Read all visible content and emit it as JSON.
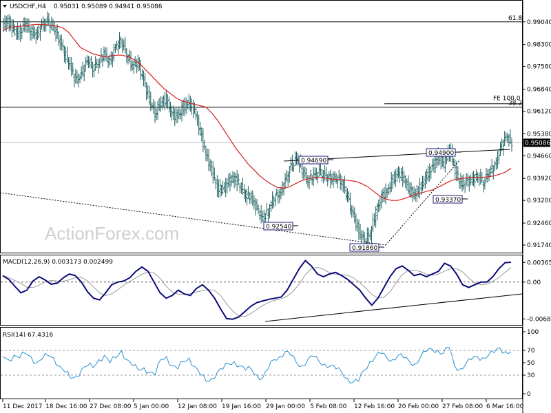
{
  "header": {
    "symbol": "USDCHF,H4",
    "ohlc": "0.95031 0.95089 0.94941 0.95086"
  },
  "watermark": "ActionForex.com",
  "colors": {
    "candle": "#1c5f5f",
    "ma": "#d42020",
    "macd": "#0a0a78",
    "signal": "#9a9a9a",
    "rsi": "#2a8fd0",
    "grid": "#000000"
  },
  "chart_data": [
    {
      "type": "candlestick",
      "title": "USDCHF,H4",
      "price_axis": {
        "ylim": [
          0.9128,
          0.9131
        ],
        "ticks": [
          "0.99040",
          "0.98300",
          "0.97580",
          "0.96840",
          "0.96120",
          "0.95380",
          "0.94660",
          "0.93920",
          "0.93200",
          "0.92460",
          "0.91740"
        ]
      },
      "current_price": "0.95086",
      "x_tick_labels": [
        "11 Dec 2017",
        "18 Dec 16:00",
        "27 Dec 08:00",
        "5 Jan 00:00",
        "12 Jan 08:00",
        "19 Jan 16:00",
        "29 Jan 00:00",
        "5 Feb 08:00",
        "12 Feb 16:00",
        "20 Feb 00:00",
        "27 Feb 08:00",
        "6 Mar 16:00"
      ],
      "close_path": [
        0.9895,
        0.9905,
        0.988,
        0.986,
        0.99,
        0.9875,
        0.986,
        0.989,
        0.9905,
        0.9885,
        0.985,
        0.9805,
        0.976,
        0.971,
        0.973,
        0.978,
        0.9755,
        0.977,
        0.98,
        0.977,
        0.982,
        0.9845,
        0.98,
        0.976,
        0.977,
        0.971,
        0.965,
        0.9605,
        0.964,
        0.965,
        0.96,
        0.9595,
        0.9625,
        0.964,
        0.961,
        0.9545,
        0.947,
        0.942,
        0.936,
        0.9355,
        0.938,
        0.9395,
        0.937,
        0.934,
        0.933,
        0.929,
        0.926,
        0.9285,
        0.933,
        0.934,
        0.938,
        0.943,
        0.946,
        0.942,
        0.9385,
        0.94,
        0.941,
        0.94,
        0.939,
        0.9395,
        0.938,
        0.933,
        0.927,
        0.922,
        0.9186,
        0.9215,
        0.928,
        0.933,
        0.935,
        0.939,
        0.941,
        0.939,
        0.935,
        0.9337,
        0.937,
        0.94,
        0.943,
        0.946,
        0.944,
        0.949,
        0.942,
        0.937,
        0.938,
        0.9385,
        0.94,
        0.938,
        0.9415,
        0.943,
        0.949,
        0.953,
        0.9509
      ],
      "ma_path": [
        0.9875,
        0.9885,
        0.9888,
        0.989,
        0.9892,
        0.9895,
        0.9896,
        0.9895,
        0.9893,
        0.989,
        0.9885,
        0.987,
        0.9845,
        0.982,
        0.981,
        0.98,
        0.9795,
        0.979,
        0.9792,
        0.9795,
        0.9795,
        0.979,
        0.978,
        0.9765,
        0.9745,
        0.9725,
        0.9705,
        0.9685,
        0.967,
        0.9655,
        0.9645,
        0.964,
        0.9635,
        0.963,
        0.9625,
        0.9605,
        0.958,
        0.955,
        0.952,
        0.949,
        0.9465,
        0.944,
        0.942,
        0.94,
        0.9385,
        0.9372,
        0.9362,
        0.936,
        0.9365,
        0.9375,
        0.9385,
        0.939,
        0.9395,
        0.9395,
        0.9393,
        0.939,
        0.9388,
        0.9387,
        0.9385,
        0.9382,
        0.9375,
        0.9365,
        0.935,
        0.9335,
        0.9325,
        0.932,
        0.932,
        0.9325,
        0.9332,
        0.934,
        0.9345,
        0.935,
        0.9355,
        0.9365,
        0.9375,
        0.9385,
        0.939,
        0.9392,
        0.9395,
        0.9395,
        0.9395,
        0.9397,
        0.94,
        0.9405,
        0.9412,
        0.9425
      ],
      "levels": [
        {
          "label": "61.8",
          "price": 0.9904,
          "style": "hline"
        },
        {
          "label": "FE 100.0",
          "price": 0.9625,
          "style": "hline"
        },
        {
          "label": "38.2",
          "price": 0.9625,
          "style": "hline-label"
        }
      ],
      "annotations": [
        "0.94690",
        "0.94900",
        "0.93370",
        "0.92540",
        "0.91860"
      ],
      "trendlines": [
        {
          "name": "neckline",
          "from": [
            0.9469,
            0.9469
          ],
          "to": [
            0.9495,
            0.9495
          ]
        },
        {
          "name": "support",
          "from": 0.937,
          "to": 0.9186
        },
        {
          "name": "rise",
          "from": 0.9186,
          "to": 0.949,
          "dashed": true
        }
      ]
    },
    {
      "type": "line",
      "title": "MACD(12,26,9) 0.003173 0.002499",
      "ylim": [
        -0.0072,
        0.0042
      ],
      "ticks": [
        "0.00365",
        "0.00",
        "-0.006858"
      ],
      "macd_path": [
        0.0012,
        0.0005,
        -0.0008,
        -0.002,
        -0.0015,
        0.0002,
        0.001,
        0.0004,
        -0.0004,
        -0.0002,
        0.0008,
        0.0015,
        0.0012,
        0.0,
        -0.0018,
        -0.003,
        -0.0033,
        -0.002,
        -0.0005,
        0.0,
        0.0002,
        0.0008,
        0.002,
        0.0028,
        0.002,
        0.0,
        -0.002,
        -0.003,
        -0.0025,
        -0.0015,
        -0.0022,
        -0.0025,
        -0.0012,
        -0.0005,
        -0.0015,
        -0.003,
        -0.005,
        -0.0068,
        -0.0069,
        -0.0065,
        -0.0055,
        -0.0045,
        -0.0038,
        -0.0035,
        -0.0032,
        -0.003,
        -0.0028,
        -0.0015,
        0.0005,
        0.0025,
        0.004,
        0.003,
        0.0015,
        0.001,
        0.0015,
        0.0018,
        0.0012,
        0.0005,
        -0.0005,
        -0.0015,
        -0.003,
        -0.0043,
        -0.003,
        -0.001,
        0.001,
        0.0025,
        0.003,
        0.0022,
        0.0012,
        0.0015,
        0.001,
        0.0015,
        0.002,
        0.0035,
        0.003,
        0.0015,
        -0.0005,
        -0.001,
        -0.0005,
        0.0,
        0.0,
        0.001,
        0.0025,
        0.0036,
        0.0037
      ]
    },
    {
      "type": "line",
      "title": "RSI(14) 67.4316",
      "ylim": [
        0,
        100
      ],
      "ticks": [
        "100",
        "70",
        "50",
        "30",
        "0"
      ],
      "rsi_path": [
        60,
        55,
        62,
        58,
        65,
        60,
        50,
        56,
        62,
        58,
        45,
        35,
        25,
        28,
        40,
        45,
        42,
        55,
        62,
        50,
        58,
        70,
        55,
        45,
        38,
        42,
        35,
        30,
        55,
        60,
        45,
        40,
        52,
        58,
        44,
        30,
        20,
        25,
        35,
        40,
        48,
        52,
        45,
        38,
        40,
        30,
        25,
        40,
        55,
        60,
        68,
        62,
        50,
        45,
        55,
        60,
        52,
        48,
        45,
        40,
        35,
        25,
        18,
        20,
        38,
        52,
        60,
        65,
        58,
        55,
        62,
        58,
        52,
        48,
        60,
        68,
        72,
        70,
        65,
        75,
        45,
        40,
        48,
        55,
        60,
        58,
        62,
        66,
        74,
        68,
        67
      ]
    }
  ]
}
